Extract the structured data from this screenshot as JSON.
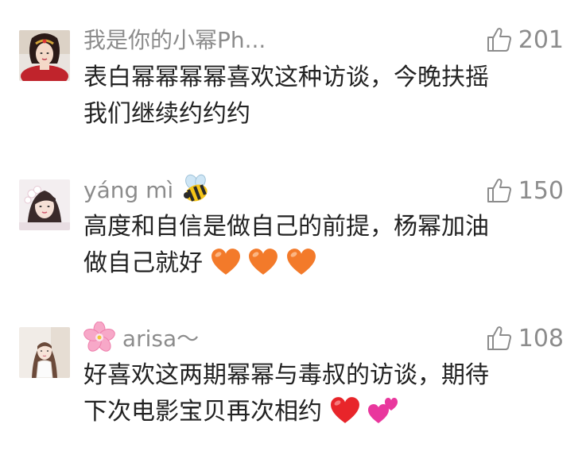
{
  "comments": [
    {
      "username": "我是你的小幂Ph...",
      "likes": "201",
      "lines": [
        "表白幂幂幂幂喜欢这种访谈，今晚扶摇",
        "我们继续约约约"
      ],
      "avatar_icon": "avatar-girl-red-costume"
    },
    {
      "username": "yáng mì",
      "username_emoji": "bee-icon",
      "likes": "150",
      "lines": [
        "高度和自信是做自己的前提，杨幂加油",
        "做自己就好"
      ],
      "line2_emojis": [
        "orange-heart-icon",
        "orange-heart-icon",
        "orange-heart-icon"
      ],
      "avatar_icon": "avatar-girl-white-flowers"
    },
    {
      "username_prefix_emoji": "cherry-blossom-icon",
      "username": "arisa～",
      "likes": "108",
      "lines": [
        "好喜欢这两期幂幂与毒叔的访谈，期待",
        "下次电影宝贝再次相约"
      ],
      "line2_emojis": [
        "red-heart-icon",
        "two-hearts-icon"
      ],
      "avatar_icon": "avatar-girl-light-photo"
    }
  ],
  "colors": {
    "username": "#8c8c8c",
    "text": "#222222",
    "like": "#8c8c8c",
    "orange_heart": "#f37a2a",
    "red_heart": "#e8252a",
    "pink_heart": "#e9379d"
  }
}
